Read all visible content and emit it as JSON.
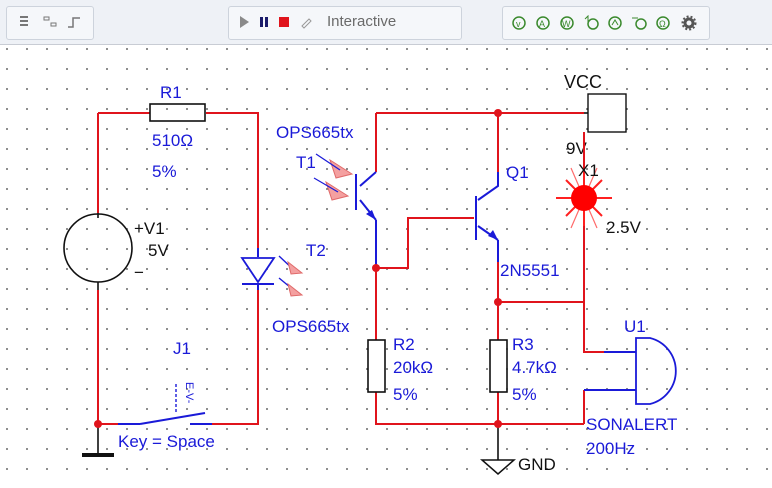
{
  "toolbar": {
    "mode_label": "Interactive",
    "icons": [
      "grip-icon",
      "align-icon",
      "step-icon",
      "play-icon",
      "pause-icon",
      "stop-icon",
      "pin-icon",
      "sim-probe-1-icon",
      "sim-probe-2-icon",
      "sim-probe-3-icon",
      "sim-probe-4-icon",
      "sim-probe-5-icon",
      "sim-probe-6-icon",
      "sim-probe-7-icon",
      "gear-icon"
    ]
  },
  "components": {
    "r1": {
      "ref": "R1",
      "value": "510Ω",
      "tol": "5%"
    },
    "v1": {
      "ref": "+V1",
      "value": "5V",
      "neg": "−"
    },
    "t1": {
      "ref": "T1",
      "part": "OPS665tx"
    },
    "t2": {
      "ref": "T2",
      "part": "OPS665tx"
    },
    "q1": {
      "ref": "Q1",
      "part": "2N5551"
    },
    "vcc": {
      "ref": "VCC",
      "value": "9V"
    },
    "x1": {
      "ref": "X1",
      "value": "2.5V"
    },
    "r2": {
      "ref": "R2",
      "value": "20kΩ",
      "tol": "5%"
    },
    "r3": {
      "ref": "R3",
      "value": "4.7kΩ",
      "tol": "5%"
    },
    "u1": {
      "ref": "U1",
      "part": "SONALERT",
      "freq": "200Hz"
    },
    "j1": {
      "ref": "J1",
      "key": "Key = Space",
      "mark": "E-V-"
    },
    "gnd": {
      "ref": "GND"
    }
  },
  "colors": {
    "wire": "#e0141c",
    "label": "#1a1ad8",
    "lamp": "#ff0000",
    "toolbar": "#eef1f6"
  }
}
